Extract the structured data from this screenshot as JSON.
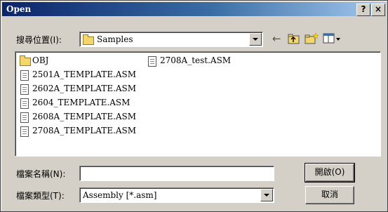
{
  "window": {
    "title": "Open",
    "help_glyph": "?",
    "close_glyph": "×"
  },
  "lookin": {
    "label": "搜尋位置(I):",
    "value": "Samples"
  },
  "toolbar": {
    "back_glyph": "←",
    "icons": [
      "back-arrow-icon",
      "up-folder-icon",
      "new-folder-icon",
      "view-menu-icon"
    ]
  },
  "files": [
    {
      "name": "OBJ",
      "icon": "folder-icon"
    },
    {
      "name": "2501A_TEMPLATE.ASM",
      "icon": "document-icon"
    },
    {
      "name": "2602A_TEMPLATE.ASM",
      "icon": "document-icon"
    },
    {
      "name": "2604_TEMPLATE.ASM",
      "icon": "document-icon"
    },
    {
      "name": "2608A_TEMPLATE.ASM",
      "icon": "document-icon"
    },
    {
      "name": "2708A_TEMPLATE.ASM",
      "icon": "document-icon"
    },
    {
      "name": "2708A_test.ASM",
      "icon": "document-icon"
    }
  ],
  "filename": {
    "label": "檔案名稱(N):",
    "value": ""
  },
  "filetype": {
    "label": "檔案類型(T):",
    "value": "Assembly [*.asm]"
  },
  "buttons": {
    "open": "開啟(O)",
    "cancel": "取消"
  },
  "colors": {
    "titlebar_start": "#0a246a",
    "titlebar_end": "#a6caf0",
    "face": "#d4d0c8"
  }
}
